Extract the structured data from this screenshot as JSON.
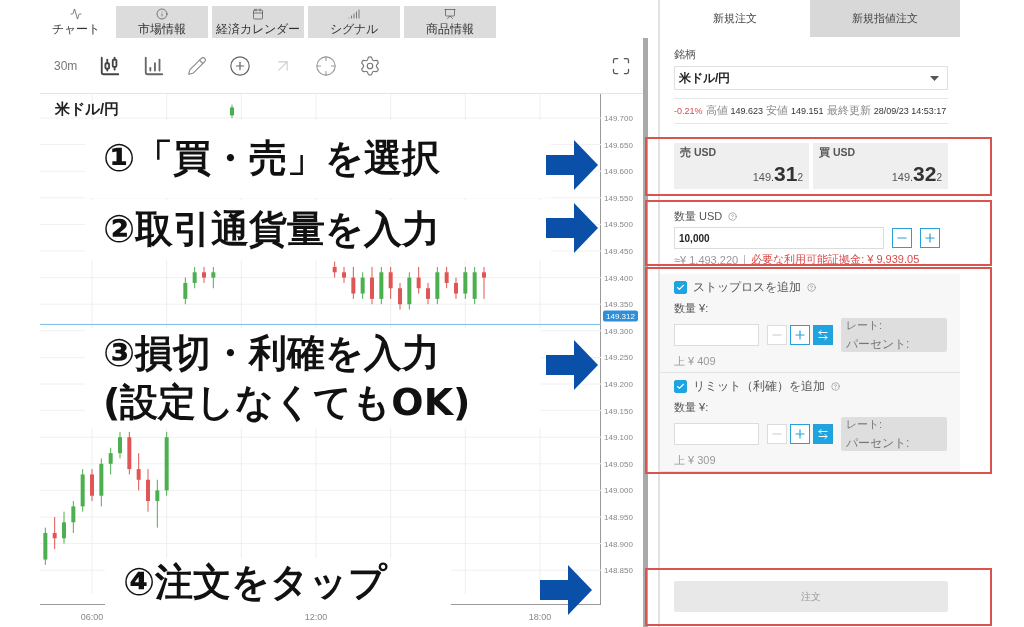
{
  "chart_panel": {
    "tabs": [
      {
        "label": "チャート",
        "selected": true,
        "kind": "chart"
      },
      {
        "label": "市場情報",
        "selected": false,
        "kind": "info"
      },
      {
        "label": "経済カレンダー",
        "selected": false,
        "kind": "calendar"
      },
      {
        "label": "シグナル",
        "selected": false,
        "kind": "signal"
      },
      {
        "label": "商品情報",
        "selected": false,
        "kind": "product"
      }
    ],
    "interval": "30m",
    "symbol": "米ドル/円",
    "price_tag": "149.312",
    "chart_data": {
      "type": "candlestick",
      "xlim": [
        4.607,
        19.634
      ],
      "ylim": [
        148.85,
        149.7
      ],
      "grid": true,
      "ref_lines": [
        {
          "axis": "y",
          "value": 149.312
        }
      ],
      "xticks": [
        {
          "value": 6,
          "label": "06:00"
        },
        {
          "value": 12,
          "label": "12:00"
        },
        {
          "value": 18,
          "label": "18:00"
        }
      ],
      "yticks": [
        {
          "value": 149.7,
          "label": "149.700"
        },
        {
          "value": 149.65,
          "label": "149.650"
        },
        {
          "value": 149.6,
          "label": "149.600"
        },
        {
          "value": 149.55,
          "label": "149.550"
        },
        {
          "value": 149.5,
          "label": "149.500"
        },
        {
          "value": 149.45,
          "label": "149.450"
        },
        {
          "value": 149.4,
          "label": "149.400"
        },
        {
          "value": 149.35,
          "label": "149.350"
        },
        {
          "value": 149.3,
          "label": "149.300"
        },
        {
          "value": 149.25,
          "label": "149.250"
        },
        {
          "value": 149.2,
          "label": "149.200"
        },
        {
          "value": 149.15,
          "label": "149.150"
        },
        {
          "value": 149.1,
          "label": "149.100"
        },
        {
          "value": 149.05,
          "label": "149.050"
        },
        {
          "value": 149.0,
          "label": "149.000"
        },
        {
          "value": 148.95,
          "label": "148.950"
        },
        {
          "value": 148.9,
          "label": "148.900"
        },
        {
          "value": 148.85,
          "label": "148.850"
        }
      ],
      "x": [
        4.75,
        5,
        5.25,
        5.5,
        5.75,
        6,
        6.25,
        6.5,
        6.75,
        7,
        7.25,
        7.5,
        7.75,
        8,
        8.5,
        8.75,
        9,
        9.25,
        9.75,
        12.5,
        12.75,
        13,
        13.25,
        13.5,
        13.75,
        14,
        14.25,
        14.5,
        14.75,
        15,
        15.25,
        15.5,
        15.75,
        16,
        16.25,
        16.5
      ],
      "ohlc": [
        [
          148.87,
          148.93,
          148.86,
          148.92
        ],
        [
          148.92,
          148.95,
          148.89,
          148.91
        ],
        [
          148.91,
          148.96,
          148.9,
          148.94
        ],
        [
          148.94,
          148.98,
          148.92,
          148.97
        ],
        [
          148.97,
          149.04,
          148.96,
          149.03
        ],
        [
          149.03,
          149.04,
          148.98,
          148.99
        ],
        [
          148.99,
          149.06,
          148.97,
          149.05
        ],
        [
          149.05,
          149.08,
          149.03,
          149.07
        ],
        [
          149.07,
          149.11,
          149.06,
          149.1
        ],
        [
          149.1,
          149.11,
          149.03,
          149.04
        ],
        [
          149.04,
          149.07,
          149.0,
          149.02
        ],
        [
          149.02,
          149.04,
          148.96,
          148.98
        ],
        [
          148.98,
          149.02,
          148.93,
          149.0
        ],
        [
          149.0,
          149.11,
          148.99,
          149.1
        ],
        [
          149.36,
          149.4,
          149.35,
          149.39
        ],
        [
          149.39,
          149.42,
          149.38,
          149.41
        ],
        [
          149.41,
          149.42,
          149.39,
          149.4
        ],
        [
          149.4,
          149.42,
          149.38,
          149.41
        ],
        [
          149.705,
          149.725,
          149.7,
          149.72
        ],
        [
          149.42,
          149.43,
          149.4,
          149.41
        ],
        [
          149.41,
          149.42,
          149.39,
          149.4
        ],
        [
          149.4,
          149.42,
          149.36,
          149.37
        ],
        [
          149.37,
          149.41,
          149.36,
          149.4
        ],
        [
          149.4,
          149.42,
          149.35,
          149.36
        ],
        [
          149.36,
          149.42,
          149.35,
          149.41
        ],
        [
          149.41,
          149.42,
          149.36,
          149.38
        ],
        [
          149.38,
          149.39,
          149.34,
          149.35
        ],
        [
          149.35,
          149.41,
          149.34,
          149.4
        ],
        [
          149.4,
          149.42,
          149.37,
          149.38
        ],
        [
          149.38,
          149.39,
          149.35,
          149.36
        ],
        [
          149.36,
          149.42,
          149.35,
          149.41
        ],
        [
          149.41,
          149.42,
          149.38,
          149.39
        ],
        [
          149.39,
          149.4,
          149.36,
          149.37
        ],
        [
          149.37,
          149.42,
          149.36,
          149.41
        ],
        [
          149.36,
          149.42,
          149.35,
          149.41
        ],
        [
          149.41,
          149.42,
          149.36,
          149.4
        ]
      ]
    }
  },
  "order_panel": {
    "tabs": [
      {
        "label": "新規注文",
        "selected": true
      },
      {
        "label": "新規指値注文",
        "selected": false
      }
    ],
    "symbol_label": "銘柄",
    "symbol_value": "米ドル/円",
    "stats": {
      "change": "-0.21%",
      "high_label": "高値",
      "high": "149.623",
      "low_label": "安値",
      "low": "149.151",
      "updated_label": "最終更新",
      "updated": "28/09/23 14:53:17"
    },
    "prices": [
      {
        "label": "売 USD",
        "value": "149.**31**$_{2}$"
      },
      {
        "label": "買 USD",
        "value": "149.**32**$_{2}$"
      }
    ],
    "quantity": {
      "label": "数量 USD",
      "value": "10,000",
      "approx": "≈¥ 1,493,220",
      "margin": "必要な利用可能証拠金: ¥ 9,939.05"
    },
    "protections": [
      {
        "label": "ストップロスを追加",
        "checked": true,
        "qty_label": "数量 ¥:",
        "rate_label": "レート:",
        "percent_label": "パーセント:",
        "hint": "上 ¥ 409"
      },
      {
        "label": "リミット（利確）を追加",
        "checked": true,
        "qty_label": "数量 ¥:",
        "rate_label": "レート:",
        "percent_label": "パーセント:",
        "hint": "上 ¥ 309"
      }
    ],
    "order_button": {
      "label": "注文",
      "disabled": true
    }
  },
  "annotations": [
    {
      "lines": [
        "①「買・売」を選択"
      ]
    },
    {
      "lines": [
        "②取引通貨量を入力"
      ]
    },
    {
      "lines": [
        "③損切・利確を入力",
        "(設定しなくてもOK)"
      ]
    },
    {
      "lines": [
        "④注文をタップ"
      ]
    }
  ]
}
